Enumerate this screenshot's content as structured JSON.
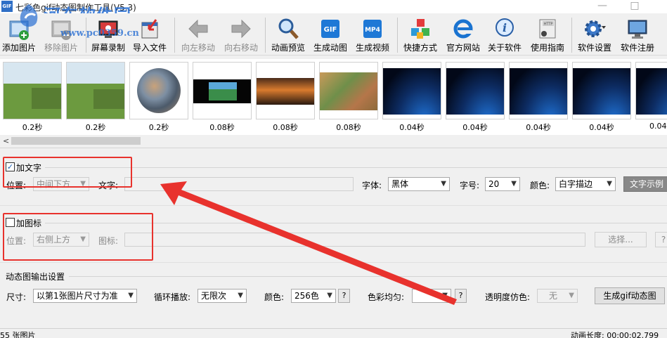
{
  "window": {
    "title": "七彩色gif动态图制作工具(V5.3)",
    "app_icon": "GIF",
    "watermark": "河东软件园",
    "watermark_url": "www.pc0359.cn",
    "min_button": "—",
    "max_button": "□"
  },
  "toolbar": {
    "buttons": [
      {
        "label": "添加图片",
        "icon": "add-image-icon"
      },
      {
        "label": "移除图片",
        "icon": "remove-image-icon"
      },
      {
        "label": "屏幕录制",
        "icon": "screen-record-icon"
      },
      {
        "label": "导入文件",
        "icon": "import-file-icon"
      },
      {
        "label": "向左移动",
        "icon": "arrow-left-icon"
      },
      {
        "label": "向右移动",
        "icon": "arrow-right-icon"
      },
      {
        "label": "动画预览",
        "icon": "magnifier-icon"
      },
      {
        "label": "生成动图",
        "icon": "gif-icon",
        "badge": "GIF"
      },
      {
        "label": "生成视频",
        "icon": "mp4-icon",
        "badge": "MP4"
      },
      {
        "label": "快捷方式",
        "icon": "cubes-icon"
      },
      {
        "label": "官方网站",
        "icon": "ie-icon"
      },
      {
        "label": "关于软件",
        "icon": "info-icon"
      },
      {
        "label": "使用指南",
        "icon": "guide-icon",
        "badge": "HTTP"
      },
      {
        "label": "软件设置",
        "icon": "gear-icon"
      },
      {
        "label": "软件注册",
        "icon": "monitor-icon"
      }
    ]
  },
  "frames": [
    {
      "caption": "0.2秒",
      "scene": "field"
    },
    {
      "caption": "0.2秒",
      "scene": "field"
    },
    {
      "caption": "0.2秒",
      "scene": "collage"
    },
    {
      "caption": "0.08秒",
      "scene": "game"
    },
    {
      "caption": "0.08秒",
      "scene": "sunset"
    },
    {
      "caption": "0.08秒",
      "scene": "town"
    },
    {
      "caption": "0.04秒",
      "scene": "earth"
    },
    {
      "caption": "0.04秒",
      "scene": "earth"
    },
    {
      "caption": "0.04秒",
      "scene": "earth"
    },
    {
      "caption": "0.04秒",
      "scene": "earth"
    },
    {
      "caption": "0.04",
      "scene": "earth"
    }
  ],
  "scroll": {
    "left_arrow": "<"
  },
  "text_section": {
    "checkbox_label": "加文字",
    "checked_mark": "✓",
    "position_label": "位置:",
    "position_value": "中间下方",
    "text_label": "文字:",
    "text_value": "",
    "font_label": "字体:",
    "font_value": "黑体",
    "size_label": "字号:",
    "size_value": "20",
    "color_label": "颜色:",
    "color_value": "白字描边",
    "example_button": "文字示例"
  },
  "icon_section": {
    "checkbox_label": "加图标",
    "position_label": "位置:",
    "position_value": "右侧上方",
    "icon_label": "图标:",
    "icon_value": "",
    "choose_button": "选择...",
    "help_button": "?"
  },
  "output": {
    "section_title": "动态图输出设置",
    "size_label": "尺寸:",
    "size_value": "以第1张图片尺寸为准",
    "loop_label": "循环播放:",
    "loop_value": "无限次",
    "color_label": "颜色:",
    "color_value": "256色",
    "help1": "?",
    "balance_label": "色彩均匀:",
    "balance_value": "",
    "help2": "?",
    "dither_label": "透明度仿色:",
    "dither_value": "无",
    "generate_button": "生成gif动态图"
  },
  "status": {
    "count": "55 张图片",
    "duration": "动画长度: 00:00:02.799"
  },
  "colors": {
    "annotation_red": "#e8322d",
    "accent_blue": "#1a5fb4"
  }
}
